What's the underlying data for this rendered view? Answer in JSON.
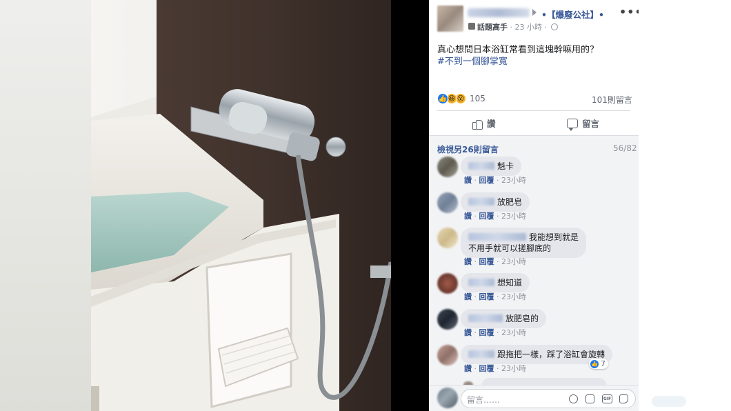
{
  "post": {
    "group_name": "•【爆廢公社】•",
    "author_role": "話題高手",
    "time": "23 小時",
    "text": "真心想問日本浴缸常看到這塊幹嘛用的？",
    "hashtag": "#不到一個腳掌寬",
    "reaction_count": "105",
    "comment_total": "101則留言"
  },
  "actions": {
    "like": "讚",
    "comment": "留言"
  },
  "comments_header": {
    "view_more": "檢視另26則留言",
    "pager": "56/82"
  },
  "comments": [
    {
      "text": "魁卡",
      "like": "讚",
      "reply": "回覆",
      "time": "23小時"
    },
    {
      "text": "放肥皂",
      "like": "讚",
      "reply": "回覆",
      "time": "23小時"
    },
    {
      "text": "我能想到就是",
      "text2": "不用手就可以搓腳底的",
      "like": "讚",
      "reply": "回覆",
      "time": "23小時"
    },
    {
      "text": "想知道",
      "like": "讚",
      "reply": "回覆",
      "time": "23小時"
    },
    {
      "text": "放肥皂的",
      "like": "讚",
      "reply": "回覆",
      "time": "23小時"
    },
    {
      "text": "跟拖把一樣，踩了浴缸會旋轉",
      "like": "讚",
      "reply": "回覆",
      "time": "23小時",
      "reactions": "7"
    }
  ],
  "composer": {
    "placeholder": "留言……"
  },
  "icons": [
    "more-icon",
    "globe-icon",
    "like-reaction-icon",
    "haha-reaction-icon",
    "wow-reaction-icon",
    "thumb-icon",
    "comment-icon",
    "smile-icon",
    "camera-icon",
    "gif-icon",
    "sticker-icon"
  ],
  "colors": {
    "link": "#385898",
    "like_blue": "#1877f2",
    "meta_gray": "#90949c",
    "comments_bg": "#f2f3f5"
  }
}
